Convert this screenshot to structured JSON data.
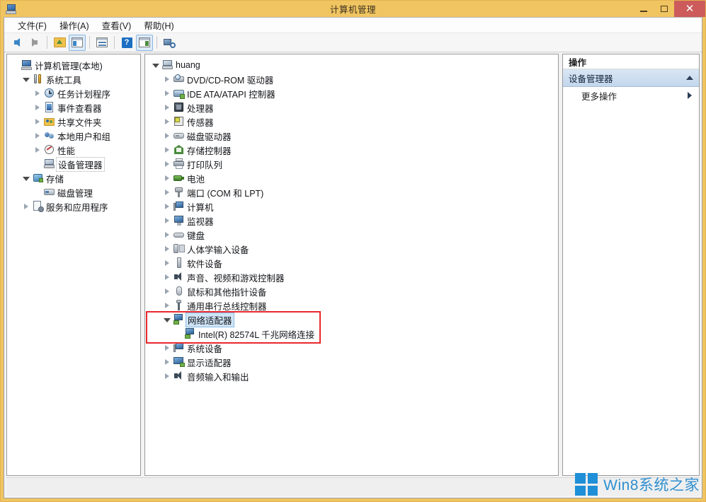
{
  "window": {
    "title": "计算机管理",
    "app_icon": "computer-management-icon",
    "accent_frame_color": "#f0c561",
    "close_button_color": "#cd5b5b",
    "controls": {
      "minimize": "minimize-icon",
      "maximize": "maximize-icon",
      "close": "✕"
    }
  },
  "menubar": {
    "items": [
      {
        "label": "文件(F)",
        "name": "menu-file"
      },
      {
        "label": "操作(A)",
        "name": "menu-action"
      },
      {
        "label": "查看(V)",
        "name": "menu-view"
      },
      {
        "label": "帮助(H)",
        "name": "menu-help"
      }
    ]
  },
  "toolbar": {
    "buttons": [
      {
        "name": "back-button",
        "icon": "arrow-left-icon",
        "enabled": true
      },
      {
        "name": "forward-button",
        "icon": "arrow-right-icon",
        "enabled": false
      },
      {
        "name": "up-one-level-button",
        "icon": "folder-up-icon",
        "enabled": true
      },
      {
        "name": "show-hide-console-tree-button",
        "icon": "tree-pane-icon",
        "pressed": true
      },
      {
        "name": "properties-button",
        "icon": "properties-icon",
        "pressed": false
      },
      {
        "name": "help-button",
        "icon": "help-icon",
        "pressed": false
      },
      {
        "name": "show-hide-action-pane-button",
        "icon": "action-pane-icon",
        "pressed": true
      },
      {
        "name": "scan-for-hardware-changes-button",
        "icon": "scan-hardware-icon",
        "pressed": false
      }
    ]
  },
  "console_tree": {
    "root": {
      "label": "计算机管理(本地)",
      "icon": "computer-icon",
      "level": 0,
      "twisty": "none"
    },
    "items": [
      {
        "label": "系统工具",
        "icon": "tools-icon",
        "level": 1,
        "twisty": "open",
        "selected": false
      },
      {
        "label": "任务计划程序",
        "icon": "clock-icon",
        "level": 2,
        "twisty": "closed",
        "selected": false
      },
      {
        "label": "事件查看器",
        "icon": "event-log-icon",
        "level": 2,
        "twisty": "closed",
        "selected": false
      },
      {
        "label": "共享文件夹",
        "icon": "shared-folder-icon",
        "level": 2,
        "twisty": "closed",
        "selected": false
      },
      {
        "label": "本地用户和组",
        "icon": "users-icon",
        "level": 2,
        "twisty": "closed",
        "selected": false
      },
      {
        "label": "性能",
        "icon": "performance-icon",
        "level": 2,
        "twisty": "closed",
        "selected": false
      },
      {
        "label": "设备管理器",
        "icon": "device-manager-icon",
        "level": 2,
        "twisty": "none",
        "selected": true
      },
      {
        "label": "存储",
        "icon": "storage-icon",
        "level": 1,
        "twisty": "open",
        "selected": false
      },
      {
        "label": "磁盘管理",
        "icon": "disk-management-icon",
        "level": 2,
        "twisty": "none",
        "selected": false
      },
      {
        "label": "服务和应用程序",
        "icon": "services-icon",
        "level": 1,
        "twisty": "closed",
        "selected": false
      }
    ]
  },
  "device_tree": {
    "root": {
      "label": "huang",
      "icon": "computer-node-icon",
      "level": 0,
      "twisty": "open"
    },
    "items": [
      {
        "label": "DVD/CD-ROM 驱动器",
        "icon": "dvd-drive-icon",
        "level": 1,
        "twisty": "closed"
      },
      {
        "label": "IDE ATA/ATAPI 控制器",
        "icon": "ide-controller-icon",
        "level": 1,
        "twisty": "closed"
      },
      {
        "label": "处理器",
        "icon": "processor-icon",
        "level": 1,
        "twisty": "closed"
      },
      {
        "label": "传感器",
        "icon": "sensor-icon",
        "level": 1,
        "twisty": "closed"
      },
      {
        "label": "磁盘驱动器",
        "icon": "disk-drive-icon",
        "level": 1,
        "twisty": "closed"
      },
      {
        "label": "存储控制器",
        "icon": "storage-controller-icon",
        "level": 1,
        "twisty": "closed"
      },
      {
        "label": "打印队列",
        "icon": "print-queue-icon",
        "level": 1,
        "twisty": "closed"
      },
      {
        "label": "电池",
        "icon": "battery-icon",
        "level": 1,
        "twisty": "closed"
      },
      {
        "label": "端口 (COM 和 LPT)",
        "icon": "ports-icon",
        "level": 1,
        "twisty": "closed"
      },
      {
        "label": "计算机",
        "icon": "computer-device-icon",
        "level": 1,
        "twisty": "closed"
      },
      {
        "label": "监视器",
        "icon": "monitor-icon",
        "level": 1,
        "twisty": "closed"
      },
      {
        "label": "键盘",
        "icon": "keyboard-icon",
        "level": 1,
        "twisty": "closed"
      },
      {
        "label": "人体学输入设备",
        "icon": "hid-icon",
        "level": 1,
        "twisty": "closed"
      },
      {
        "label": "软件设备",
        "icon": "software-device-icon",
        "level": 1,
        "twisty": "closed"
      },
      {
        "label": "声音、视频和游戏控制器",
        "icon": "sound-controller-icon",
        "level": 1,
        "twisty": "closed"
      },
      {
        "label": "鼠标和其他指针设备",
        "icon": "mouse-icon",
        "level": 1,
        "twisty": "closed"
      },
      {
        "label": "通用串行总线控制器",
        "icon": "usb-controller-icon",
        "level": 1,
        "twisty": "closed"
      },
      {
        "label": "网络适配器",
        "icon": "network-adapter-icon",
        "level": 1,
        "twisty": "open",
        "selected": true
      },
      {
        "label": "Intel(R) 82574L 千兆网络连接",
        "icon": "network-adapter-icon",
        "level": 2,
        "twisty": "none"
      },
      {
        "label": "系统设备",
        "icon": "system-device-icon",
        "level": 1,
        "twisty": "closed"
      },
      {
        "label": "显示适配器",
        "icon": "display-adapter-icon",
        "level": 1,
        "twisty": "closed"
      },
      {
        "label": "音频输入和输出",
        "icon": "audio-io-icon",
        "level": 1,
        "twisty": "closed"
      }
    ]
  },
  "annotation": {
    "type": "red-rectangle-highlight",
    "color": "#e8282d",
    "targets": [
      "网络适配器",
      "Intel(R) 82574L 千兆网络连接"
    ]
  },
  "actions_pane": {
    "title": "操作",
    "group_header": {
      "label": "设备管理器",
      "collapse_icon": "chevron-up-icon"
    },
    "items": [
      {
        "label": "更多操作",
        "submenu_icon": "chevron-right-icon"
      }
    ]
  },
  "statusbar": {
    "text": ""
  },
  "watermark": {
    "text": "Win8系统之家",
    "logo": "windows-logo-icon",
    "color": "#2f8fd0"
  }
}
